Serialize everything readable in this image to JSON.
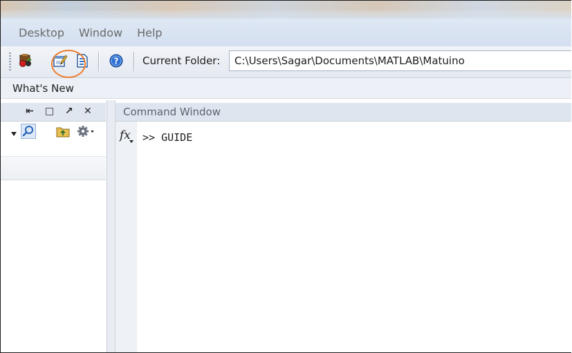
{
  "menubar": {
    "items": [
      "Desktop",
      "Window",
      "Help"
    ]
  },
  "toolbar": {
    "icons": [
      "simulink-icon",
      "guide-icon",
      "profiler-icon",
      "help-icon"
    ],
    "current_folder_label": "Current Folder:",
    "current_folder_value": "C:\\Users\\Sagar\\Documents\\MATLAB\\Matuino",
    "highlight_color": "#ee7c2d"
  },
  "shortcuts": {
    "whats_new": "What's New"
  },
  "left_panel": {
    "controls": [
      "⇤",
      "□",
      "↗",
      "✕"
    ]
  },
  "command_window": {
    "title": "Command Window",
    "fx_label": "fx",
    "prompt_line": ">> GUIDE"
  }
}
